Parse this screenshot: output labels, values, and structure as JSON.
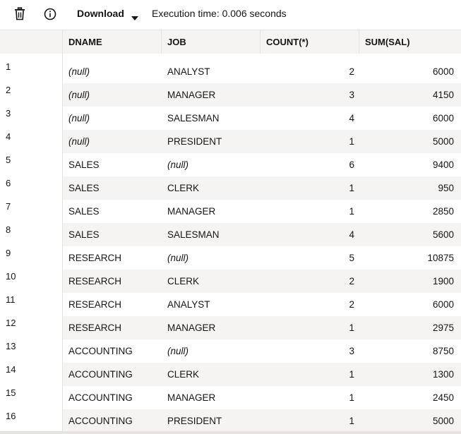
{
  "toolbar": {
    "delete_icon": "trash-icon",
    "info_icon": "info-icon",
    "download_label": "Download",
    "execution_time": "Execution time: 0.006 seconds"
  },
  "grid": {
    "columns": [
      "DNAME",
      "JOB",
      "COUNT(*)",
      "SUM(SAL)"
    ],
    "rows": [
      {
        "n": "1",
        "dname": "(null)",
        "job": "ANALYST",
        "count": "2",
        "sum": "6000"
      },
      {
        "n": "2",
        "dname": "(null)",
        "job": "MANAGER",
        "count": "3",
        "sum": "4150"
      },
      {
        "n": "3",
        "dname": "(null)",
        "job": "SALESMAN",
        "count": "4",
        "sum": "6000"
      },
      {
        "n": "4",
        "dname": "(null)",
        "job": "PRESIDENT",
        "count": "1",
        "sum": "5000"
      },
      {
        "n": "5",
        "dname": "SALES",
        "job": "(null)",
        "count": "6",
        "sum": "9400"
      },
      {
        "n": "6",
        "dname": "SALES",
        "job": "CLERK",
        "count": "1",
        "sum": "950"
      },
      {
        "n": "7",
        "dname": "SALES",
        "job": "MANAGER",
        "count": "1",
        "sum": "2850"
      },
      {
        "n": "8",
        "dname": "SALES",
        "job": "SALESMAN",
        "count": "4",
        "sum": "5600"
      },
      {
        "n": "9",
        "dname": "RESEARCH",
        "job": "(null)",
        "count": "5",
        "sum": "10875"
      },
      {
        "n": "10",
        "dname": "RESEARCH",
        "job": "CLERK",
        "count": "2",
        "sum": "1900"
      },
      {
        "n": "11",
        "dname": "RESEARCH",
        "job": "ANALYST",
        "count": "2",
        "sum": "6000"
      },
      {
        "n": "12",
        "dname": "RESEARCH",
        "job": "MANAGER",
        "count": "1",
        "sum": "2975"
      },
      {
        "n": "13",
        "dname": "ACCOUNTING",
        "job": "(null)",
        "count": "3",
        "sum": "8750"
      },
      {
        "n": "14",
        "dname": "ACCOUNTING",
        "job": "CLERK",
        "count": "1",
        "sum": "1300"
      },
      {
        "n": "15",
        "dname": "ACCOUNTING",
        "job": "MANAGER",
        "count": "1",
        "sum": "2450"
      },
      {
        "n": "16",
        "dname": "ACCOUNTING",
        "job": "PRESIDENT",
        "count": "1",
        "sum": "5000"
      }
    ]
  }
}
